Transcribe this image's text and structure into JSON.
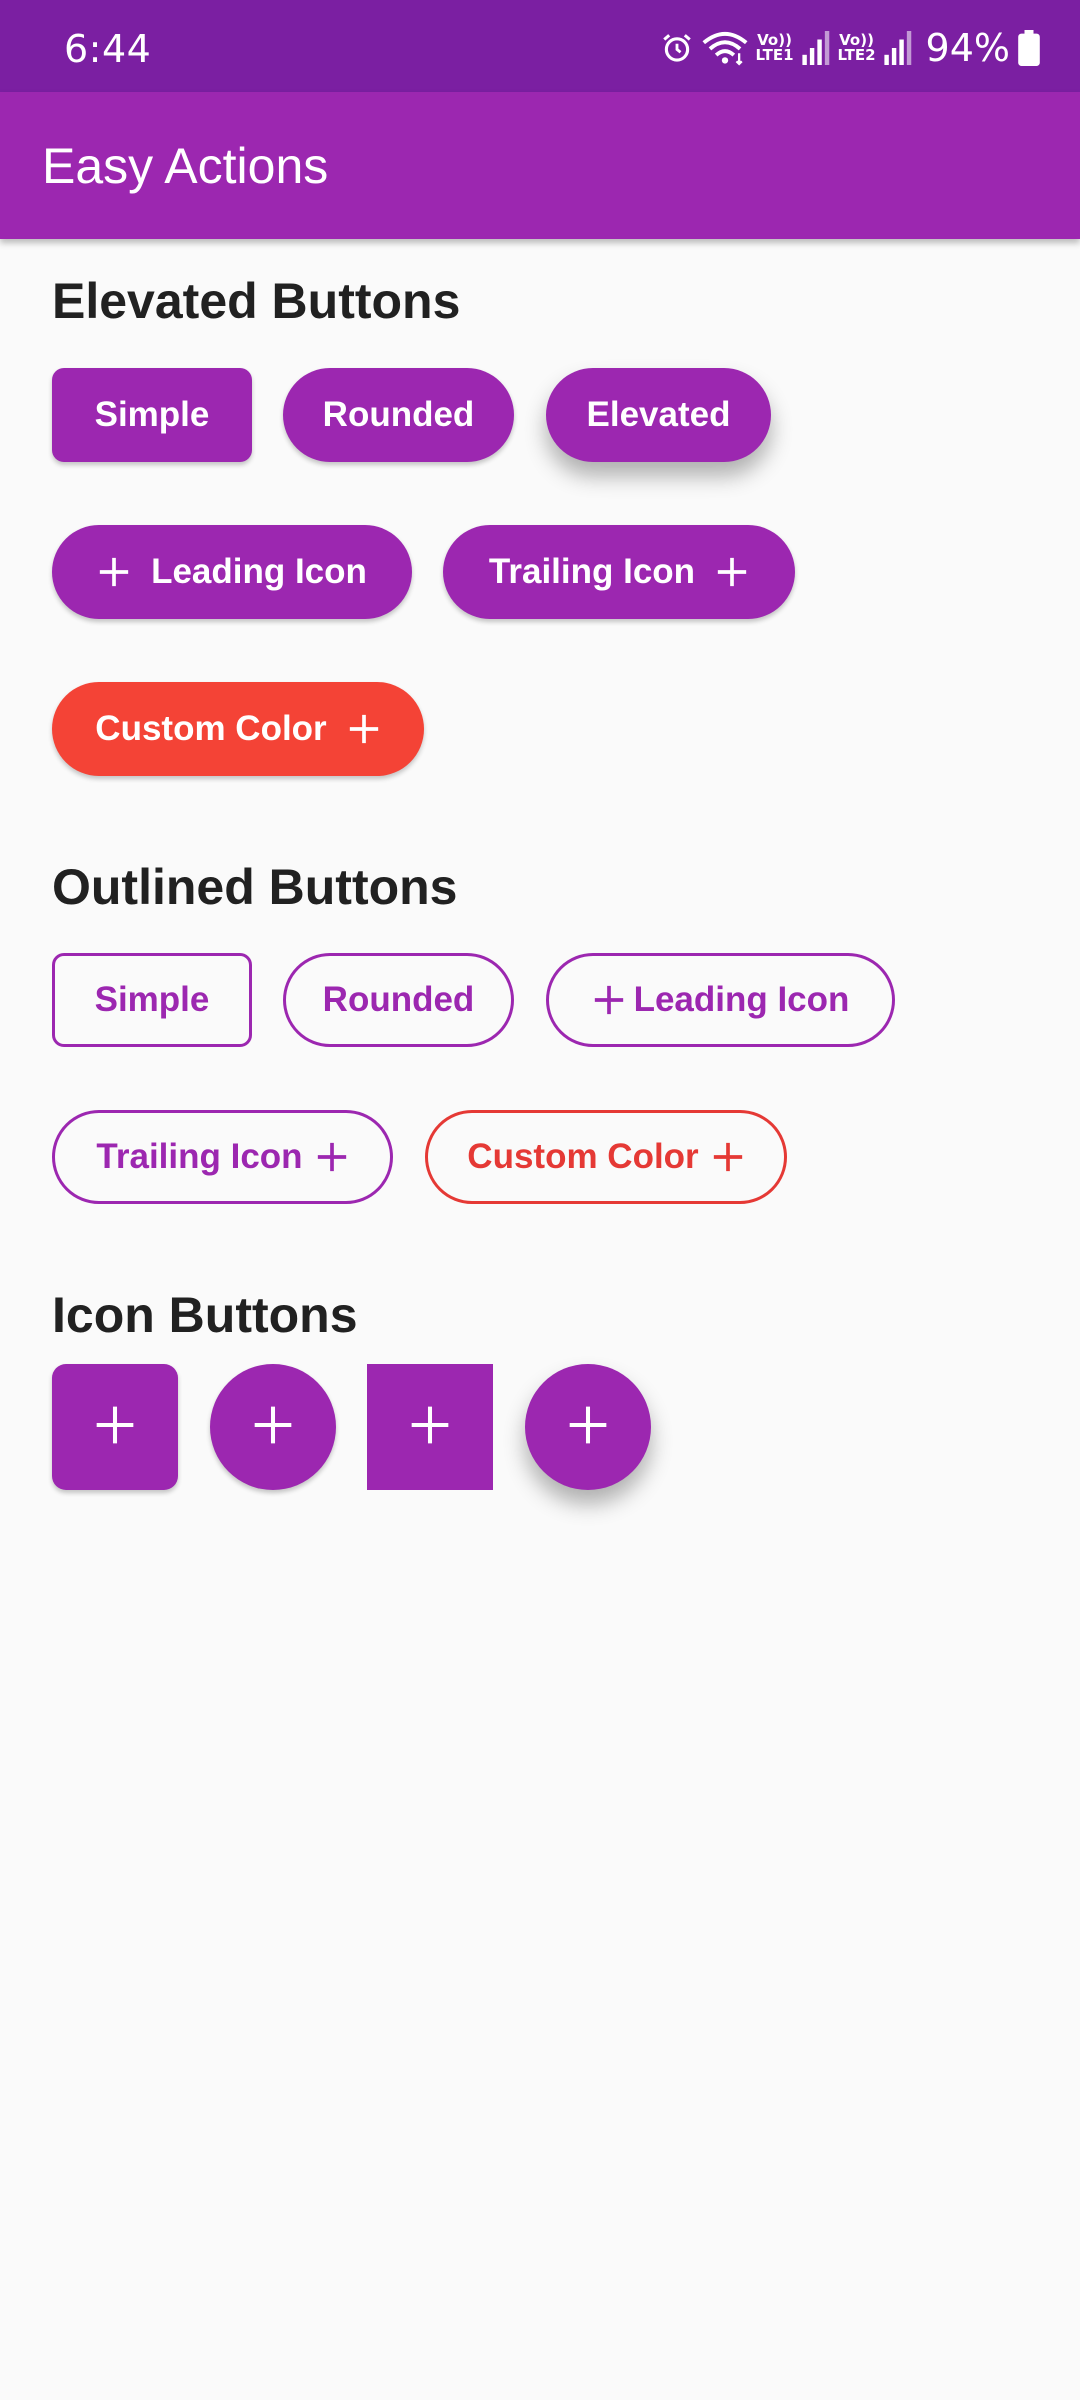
{
  "status_bar": {
    "time": "6:44",
    "sim1_label_top": "Vo))",
    "sim1_label_bottom": "LTE1",
    "sim2_label_top": "Vo))",
    "sim2_label_bottom": "LTE2",
    "battery": "94%",
    "icons": [
      "alarm-icon",
      "wifi-icon",
      "signal-icon",
      "signal-icon",
      "battery-icon"
    ]
  },
  "app_bar": {
    "title": "Easy Actions"
  },
  "colors": {
    "primary": "#9C27B0",
    "primary_dark": "#7B1FA2",
    "custom_red": "#F44336",
    "background": "#FAFAFA",
    "text_dark": "#212121"
  },
  "elevated": {
    "title": "Elevated Buttons",
    "simple": "Simple",
    "rounded": "Rounded",
    "elevated": "Elevated",
    "leading_icon": "Leading Icon",
    "trailing_icon": "Trailing Icon",
    "custom_color": "Custom Color"
  },
  "outlined": {
    "title": "Outlined Buttons",
    "simple": "Simple",
    "rounded": "Rounded",
    "leading_icon": "Leading Icon",
    "trailing_icon": "Trailing Icon",
    "custom_color": "Custom Color"
  },
  "icon_buttons": {
    "title": "Icon Buttons",
    "icons": [
      "add-icon",
      "add-icon",
      "add-icon",
      "add-icon"
    ]
  }
}
